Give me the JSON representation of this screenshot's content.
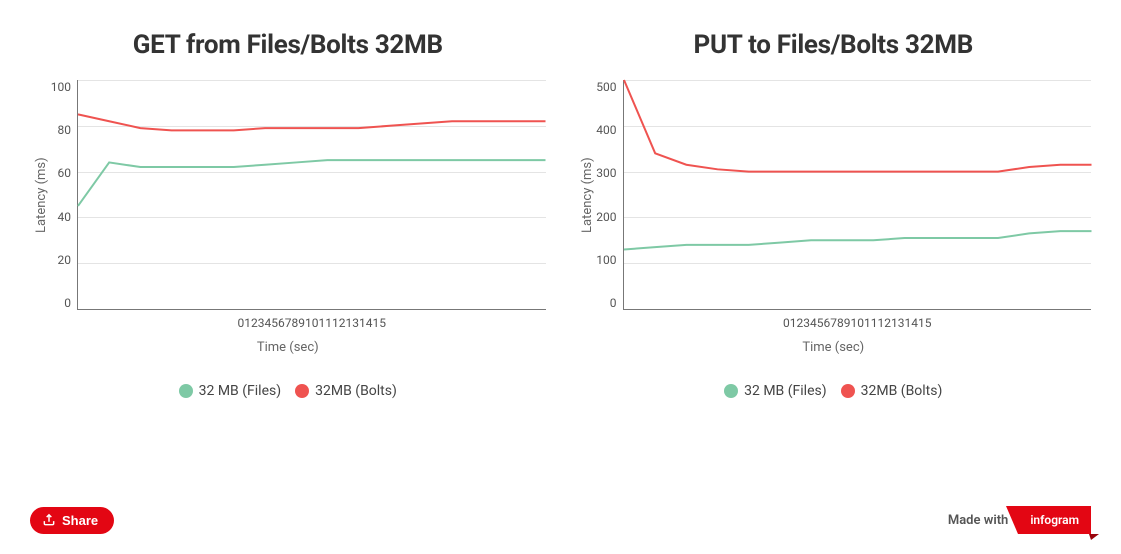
{
  "colors": {
    "files": "#7ec9a5",
    "bolts": "#ef5350"
  },
  "share_label": "Share",
  "made_with_label": "Made with",
  "brand": "infogram",
  "chart_data": [
    {
      "type": "line",
      "title": "GET from Files/Bolts 32MB",
      "xlabel": "Time (sec)",
      "ylabel": "Latency (ms)",
      "ylim": [
        0,
        100
      ],
      "yticks": [
        0,
        20,
        40,
        60,
        80,
        100
      ],
      "x": [
        0,
        1,
        2,
        3,
        4,
        5,
        6,
        7,
        8,
        9,
        10,
        11,
        12,
        13,
        14,
        15
      ],
      "series": [
        {
          "name": "32 MB (Files)",
          "color": "#7ec9a5",
          "values": [
            45,
            64,
            62,
            62,
            62,
            62,
            63,
            64,
            65,
            65,
            65,
            65,
            65,
            65,
            65,
            65
          ]
        },
        {
          "name": "32MB (Bolts)",
          "color": "#ef5350",
          "values": [
            85,
            82,
            79,
            78,
            78,
            78,
            79,
            79,
            79,
            79,
            80,
            81,
            82,
            82,
            82,
            82
          ]
        }
      ]
    },
    {
      "type": "line",
      "title": "PUT to Files/Bolts 32MB",
      "xlabel": "Time (sec)",
      "ylabel": "Latency (ms)",
      "ylim": [
        0,
        500
      ],
      "yticks": [
        0,
        100,
        200,
        300,
        400,
        500
      ],
      "x": [
        0,
        1,
        2,
        3,
        4,
        5,
        6,
        7,
        8,
        9,
        10,
        11,
        12,
        13,
        14,
        15
      ],
      "series": [
        {
          "name": "32 MB (Files)",
          "color": "#7ec9a5",
          "values": [
            130,
            135,
            140,
            140,
            140,
            145,
            150,
            150,
            150,
            155,
            155,
            155,
            155,
            165,
            170,
            170
          ]
        },
        {
          "name": "32MB (Bolts)",
          "color": "#ef5350",
          "values": [
            500,
            340,
            315,
            305,
            300,
            300,
            300,
            300,
            300,
            300,
            300,
            300,
            300,
            310,
            315,
            315
          ]
        }
      ]
    }
  ]
}
